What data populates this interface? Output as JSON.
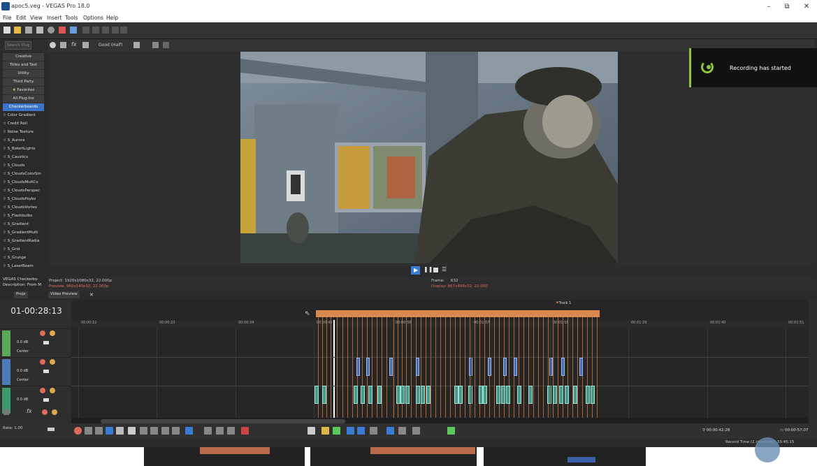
{
  "window": {
    "title": "apoc5.veg - VEGAS Pro 18.0",
    "minimize": "–",
    "maximize": "⧉",
    "close": "✕"
  },
  "menu": [
    "File",
    "Edit",
    "View",
    "Insert",
    "Tools",
    "Options",
    "Help"
  ],
  "plugins": {
    "search_placeholder": "Search Plug",
    "categories": [
      "Creative",
      "Titles and Text",
      "Utility",
      "Third Party",
      "Favorites",
      "All Plug-Ins",
      "Checkerboards"
    ],
    "items": [
      "Color Gradient",
      "Credit Roll",
      "Noise Texture",
      "S_Aurora",
      "S_BokehLights",
      "S_Caustics",
      "S_Clouds",
      "S_CloudsColorSm",
      "S_CloudsMultCo",
      "S_CloudsPerspec",
      "S_CloudsPsyko",
      "S_CloudsVortex",
      "S_Flashbulbs",
      "S_Gradient",
      "S_GradientMulti",
      "S_GradientRadia",
      "S_Grid",
      "S_Grunge",
      "S_LaserBeam"
    ],
    "footer_name": "VEGAS Checkerbo",
    "footer_desc": "Description: From M",
    "project_tab": "Proje"
  },
  "preview": {
    "quality": "Good (Half)",
    "project_info": "Project:  1920x1080x32, 22.000p",
    "preview_info": "Preview:  960x540x32, 22.000p",
    "frame_label": "Frame:",
    "frame_value": "632",
    "display_info": "Display:  667x499x32, 22.000"
  },
  "notification": {
    "text": "Recording has started",
    "accent": "#8cc63f"
  },
  "tabs": [
    "Video Preview"
  ],
  "timeline": {
    "timecode": "01-00:28:13",
    "track_marker": "Track 1",
    "ruler": [
      "00:00:12",
      "00:00:23",
      "00:00:34",
      "00:00:45",
      "00:00:56",
      "00:01:07",
      "00:01:18",
      "00:01:29",
      "00:01:40",
      "00:01:51"
    ],
    "tracks": [
      {
        "level": "0.0 dB",
        "pan": "Center",
        "color": "#5aa85a"
      },
      {
        "level": "0.0 dB",
        "pan": "Center",
        "color": "#4a7bb8"
      },
      {
        "level": "0.0 dB",
        "pan": "",
        "color": "#3c9a6a"
      }
    ],
    "rate_label": "Rate: 1.00"
  },
  "status": {
    "position": "00:00:42:28",
    "end": "00:00:57:07",
    "record_time": "Record Time (2 channels): 33:45:15"
  }
}
